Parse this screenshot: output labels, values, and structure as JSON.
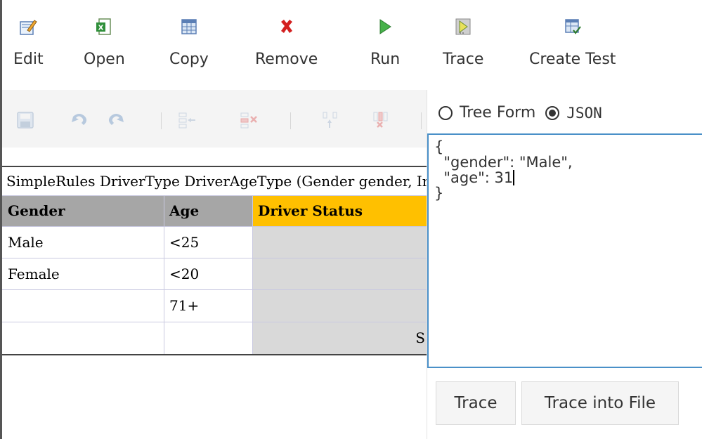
{
  "toolbar": {
    "buttons": [
      {
        "label": "Edit",
        "icon": "edit-icon"
      },
      {
        "label": "Open",
        "icon": "excel-icon"
      },
      {
        "label": "Copy",
        "icon": "copy-table-icon"
      },
      {
        "label": "Remove",
        "icon": "remove-x-icon"
      },
      {
        "label": "Run",
        "icon": "run-play-icon"
      },
      {
        "label": "Trace",
        "icon": "trace-icon"
      },
      {
        "label": "Create Test",
        "icon": "create-test-icon"
      }
    ]
  },
  "subbar": {
    "icons": [
      "save-icon",
      "undo-icon",
      "redo-icon",
      "insert-row-icon",
      "delete-row-icon",
      "insert-column-icon",
      "delete-column-icon"
    ]
  },
  "table": {
    "signature": "SimpleRules DriverType DriverAgeType (Gender gender, Integer age)",
    "headers": [
      "Gender",
      "Age",
      "Driver Status"
    ],
    "rows": [
      [
        "Male",
        "<25",
        ""
      ],
      [
        "Female",
        "<20",
        ""
      ],
      [
        "",
        "71+",
        ""
      ],
      [
        "",
        "",
        "S"
      ]
    ],
    "colors": {
      "header_bg": "#a6a6a6",
      "status_header_bg": "#ffc000",
      "status_cell_bg": "#d9d9d9"
    }
  },
  "panel": {
    "radio_tree": "Tree Form",
    "radio_json": "JSON",
    "selected": "JSON",
    "json_lines": [
      "{",
      "  \"gender\": \"Male\",",
      "  \"age\": 31",
      "}"
    ],
    "trace_button": "Trace",
    "trace_file_button": "Trace into File"
  }
}
